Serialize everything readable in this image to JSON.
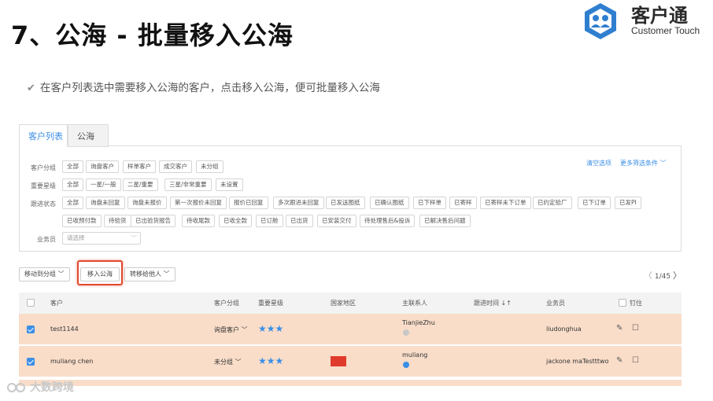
{
  "slide": {
    "title": "7、公海 - 批量移入公海",
    "tip": "在客户列表选中需要移入公海的客户，点击移入公海，便可批量移入公海"
  },
  "logo": {
    "cn": "客户通",
    "en": "Customer Touch"
  },
  "tabs": [
    {
      "label": "客户列表"
    },
    {
      "label": "公海"
    }
  ],
  "filters": {
    "group_label": "客户分组",
    "group_options": [
      "全部",
      "询盘客户",
      "样单客户",
      "成交客户",
      "未分组"
    ],
    "star_label": "重要星级",
    "star_options": [
      "全部",
      "一星/一般",
      "二星/重要",
      "三星/非常重要",
      "未设置"
    ],
    "status_label": "跟进状态",
    "status_options_1": [
      "全部",
      "询盘未回复",
      "询盘未报价",
      "第一次报价未回复",
      "报价已回复",
      "多次跟进未回复",
      "已发送图纸",
      "已确认图纸",
      "已下样单",
      "已寄样",
      "已寄样未下订单",
      "已约定验厂",
      "已下订单",
      "已发PI"
    ],
    "status_options_2": [
      "已收预付款",
      "待验货",
      "已出验货报告",
      "待收尾款",
      "已收全款",
      "已订舱",
      "已出货",
      "已安装交付",
      "待处理售后&投诉",
      "已解决售后问题"
    ],
    "sales_label": "业务员",
    "sales_placeholder": "请选择",
    "clear_link": "清空选项",
    "more_link": "更多筛选条件"
  },
  "actions": {
    "move_group": "移动到分组",
    "move_sea": "移入公海",
    "transfer": "转移给他人"
  },
  "pager": {
    "text": "1/45"
  },
  "table": {
    "headers": {
      "customer": "客户",
      "group": "客户分组",
      "star": "重要星级",
      "region": "国家地区",
      "contact": "主联系人",
      "follow_time": "跟进时间",
      "sales": "业务员",
      "pin": "钉住"
    },
    "rows": [
      {
        "customer": "test1144",
        "group": "询盘客户",
        "contact": "TianjieZhu",
        "sales": "liudonghua",
        "stars": "★★★"
      },
      {
        "customer": "muliang chen",
        "group": "未分组",
        "contact": "muliang",
        "sales": "jackone maTestttwo",
        "stars": "★★★"
      }
    ]
  },
  "watermark": {
    "text": "大数跨境"
  },
  "colors": {
    "accent": "#3a8ee6",
    "highlight": "#e04a2f",
    "row_selected": "#f9ddc9",
    "flag": "#e03a2c"
  }
}
